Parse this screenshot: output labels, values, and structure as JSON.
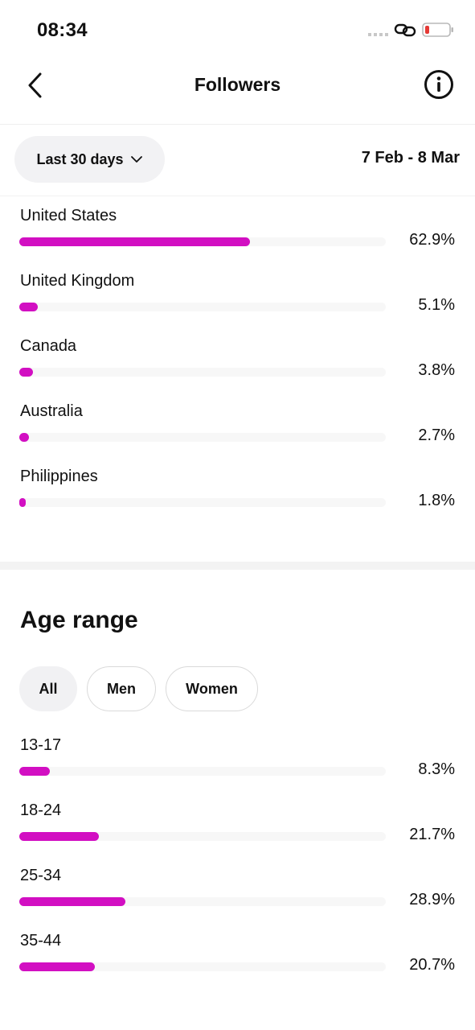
{
  "status_bar": {
    "time": "08:34"
  },
  "header": {
    "title": "Followers",
    "back_icon": "chevron-left-icon",
    "info_icon": "info-icon"
  },
  "filters": {
    "period_label": "Last 30 days",
    "date_range": "7 Feb - 8 Mar"
  },
  "countries": [
    {
      "name": "United States",
      "value": "62.9%",
      "percent": 62.9
    },
    {
      "name": "United Kingdom",
      "value": "5.1%",
      "percent": 5.1
    },
    {
      "name": "Canada",
      "value": "3.8%",
      "percent": 3.8
    },
    {
      "name": "Australia",
      "value": "2.7%",
      "percent": 2.7
    },
    {
      "name": "Philippines",
      "value": "1.8%",
      "percent": 1.8
    }
  ],
  "age_range": {
    "title": "Age range",
    "tabs": [
      {
        "label": "All",
        "selected": true
      },
      {
        "label": "Men",
        "selected": false
      },
      {
        "label": "Women",
        "selected": false
      }
    ],
    "items": [
      {
        "name": "13-17",
        "value": "8.3%",
        "percent": 8.3
      },
      {
        "name": "18-24",
        "value": "21.7%",
        "percent": 21.7
      },
      {
        "name": "25-34",
        "value": "28.9%",
        "percent": 28.9
      },
      {
        "name": "35-44",
        "value": "20.7%",
        "percent": 20.7
      }
    ]
  },
  "colors": {
    "accent": "#d20fc2",
    "track": "#f7f7f7",
    "chip_selected": "#f1f1f3"
  }
}
